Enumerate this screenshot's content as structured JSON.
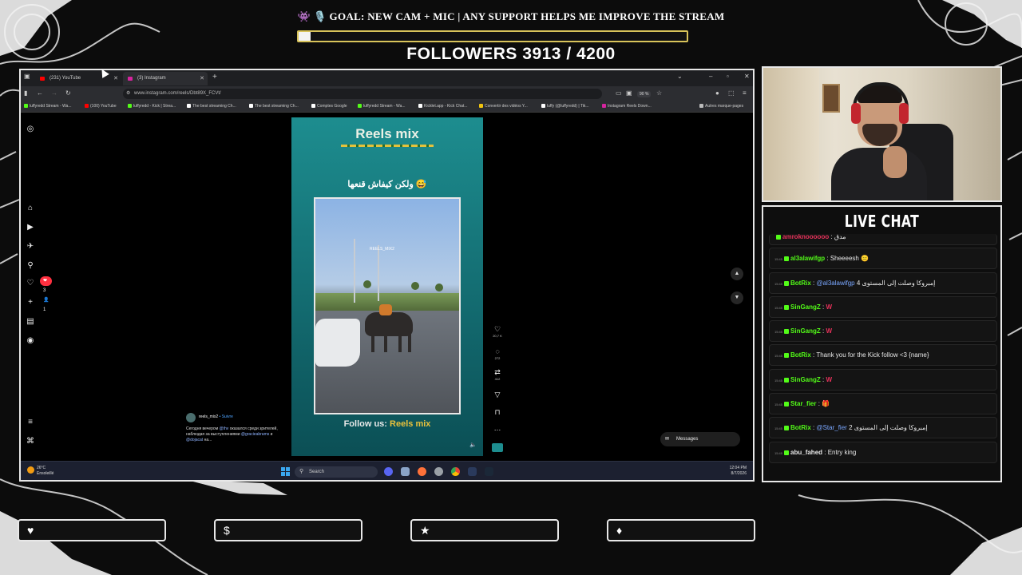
{
  "overlay": {
    "goal_text": "👾 🎙️ GOAL: NEW CAM + MIC | ANY SUPPORT HELPS ME IMPROVE THE STREAM",
    "goal_progress": 0.03,
    "followers_text": "FOLLOWERS 3913 / 4200",
    "followers_current": 3913,
    "followers_target": 4200,
    "accent_color": "#d8c35a"
  },
  "browser": {
    "tabs": [
      {
        "label": "(231) YouTube",
        "icon": "youtube-icon",
        "color": "#ff0000",
        "active": false
      },
      {
        "label": "(3) Instagram",
        "icon": "instagram-icon",
        "color": "#d6249f",
        "active": true
      }
    ],
    "new_tab": "+",
    "url": "www.instagram.com/reels/Dbt89X_FCVt/",
    "zoom": "90 %",
    "bookmarks": [
      {
        "label": "luffyredd Stream - Wa...",
        "color": "#53fc18"
      },
      {
        "label": "(100) YouTube",
        "color": "#ff0000"
      },
      {
        "label": "luffyredd - Kick | Strea...",
        "color": "#53fc18"
      },
      {
        "label": "The best streaming Ch...",
        "color": "#ffffff"
      },
      {
        "label": "The best streaming Ch...",
        "color": "#ffffff"
      },
      {
        "label": "Comptes Google",
        "color": "#ffffff"
      },
      {
        "label": "luffyredd Stream - Wa...",
        "color": "#53fc18"
      },
      {
        "label": "Kicklet.app - Kick Chat...",
        "color": "#ffffff"
      },
      {
        "label": "Convertir des vidéos Y...",
        "color": "#f1c40f"
      },
      {
        "label": "luffy (@luffyredd) | Tik...",
        "color": "#ffffff"
      },
      {
        "label": "Instagram Reels Down...",
        "color": "#d6249f"
      }
    ],
    "other_bookmarks": "Autres marque-pages"
  },
  "instagram": {
    "notifications": "❤ 3  👤 1",
    "reel": {
      "title": "Reels mix",
      "arabic_caption": "ولكن كيفاش قنعها 😅",
      "watermark": "REELS_MIX2",
      "follow_prefix": "Follow us: ",
      "follow_name": "Reels mix",
      "likes": "20,7 K",
      "comments": "272",
      "reposts": "412"
    },
    "caption": {
      "username": "reels_mix2",
      "follow_label": "• Suivre",
      "text": "Сегодня вечером",
      "mention1": "@thv",
      "text2": "оказался среди зрителей, наблюдая за выступлениями",
      "mention2": "@gracieabrams",
      "text3": "и",
      "mention3": "@dojacat",
      "text4": "на..."
    },
    "messages_label": "Messages"
  },
  "taskbar": {
    "temperature": "26°C",
    "weather": "Ensoleillé",
    "search_label": "Search",
    "time": "12:04 PM",
    "date": "8/7/2026"
  },
  "chat": {
    "title": "LIVE CHAT",
    "messages": [
      {
        "time": "",
        "badge_color": "#53fc18",
        "user": "amroknoooooo",
        "user_color": "#e7315a",
        "text": "مدق",
        "partial": true
      },
      {
        "time": "15:45",
        "badge_color": "#53fc18",
        "user": "al3alawifgp",
        "user_color": "#53fc18",
        "text": "Sheeeesh 😑"
      },
      {
        "time": "15:45",
        "badge_color": "#53fc18",
        "user": "BotRix",
        "user_color": "#53fc18",
        "mention": "@al3alawifgp",
        "text": "إمبروكا وصلت إلى المستوى 4"
      },
      {
        "time": "15:45",
        "badge_color": "#53fc18",
        "user": "SinGangZ",
        "user_color": "#53fc18",
        "text": "W",
        "text_color": "#e7315a"
      },
      {
        "time": "15:45",
        "badge_color": "#53fc18",
        "user": "SinGangZ",
        "user_color": "#53fc18",
        "text": "W",
        "text_color": "#e7315a"
      },
      {
        "time": "15:45",
        "badge_color": "#53fc18",
        "user": "BotRix",
        "user_color": "#53fc18",
        "text": "Thank you for the Kick follow <3 {name}"
      },
      {
        "time": "15:45",
        "badge_color": "#53fc18",
        "user": "SinGangZ",
        "user_color": "#53fc18",
        "text": "W",
        "text_color": "#e7315a"
      },
      {
        "time": "15:45",
        "badge_color": "#53fc18",
        "user": "Star_fier",
        "user_color": "#53fc18",
        "text": "🎁"
      },
      {
        "time": "15:45",
        "badge_color": "#53fc18",
        "user": "BotRix",
        "user_color": "#53fc18",
        "mention": "@Star_fier",
        "text": "إمبروكا وصلت إلى المستوى 2"
      },
      {
        "time": "15:45",
        "badge_color": "#53fc18",
        "user": "abu_fahed",
        "user_color": "#e8e8e8",
        "text": "Entry king"
      }
    ]
  },
  "support_buttons": [
    {
      "icon": "heart-icon",
      "glyph": "♥",
      "label": ""
    },
    {
      "icon": "dollar-icon",
      "glyph": "$",
      "label": ""
    },
    {
      "icon": "star-icon",
      "glyph": "★",
      "label": ""
    },
    {
      "icon": "diamond-icon",
      "glyph": "♦",
      "label": ""
    }
  ]
}
